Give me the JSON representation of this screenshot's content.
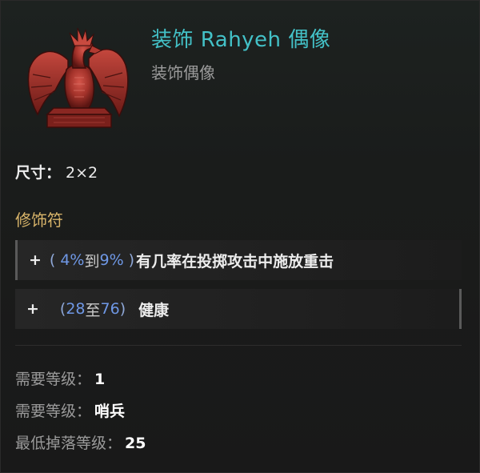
{
  "item": {
    "title": "装饰 Rahyeh 偶像",
    "subtitle": "装饰偶像",
    "icon": "red-dragon-statue-icon"
  },
  "size": {
    "label": "尺寸：",
    "value": "2×2"
  },
  "modifiers": {
    "title": "修饰符",
    "affixes": [
      {
        "plus": "+",
        "open": "(",
        "min": "4%",
        "connector": "到",
        "max": "9%",
        "close": ")",
        "text": "有几率在投掷攻击中施放重击"
      },
      {
        "plus": "+",
        "open": "(",
        "min": "28",
        "connector": "至",
        "max": "76",
        "close": ")",
        "text": "健康"
      }
    ]
  },
  "requirements": [
    {
      "label": "需要等级：",
      "value": "1"
    },
    {
      "label": "需要等级：",
      "value": "哨兵"
    },
    {
      "label": "最低掉落等级：",
      "value": "25"
    }
  ],
  "colors": {
    "title": "#43c1c7",
    "section": "#d9b56a",
    "range_number": "#6f98e6",
    "statue_red": "#a3322a"
  }
}
